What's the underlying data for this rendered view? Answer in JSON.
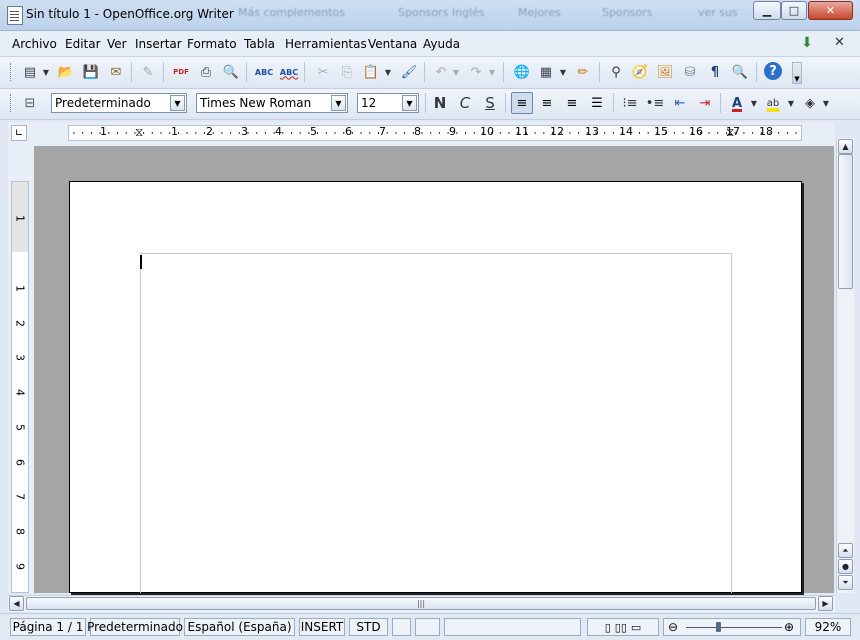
{
  "window": {
    "title": "Sin título 1 - OpenOffice.org Writer",
    "background_tabs": [
      "Más complementos",
      "Sponsors Inglés",
      "Mejores",
      "Sponsors",
      "ver sus"
    ],
    "buttons": {
      "minimize": "▁",
      "maximize": "□",
      "close": "✕"
    }
  },
  "menu": [
    "Archivo",
    "Editar",
    "Ver",
    "Insertar",
    "Formato",
    "Tabla",
    "Herramientas",
    "Ventana",
    "Ayuda"
  ],
  "toolbar_standard": {
    "icons": [
      "new-icon",
      "open-icon",
      "save-icon",
      "email-icon",
      "edit-file-icon",
      "export-pdf-icon",
      "print-icon",
      "page-preview-icon",
      "spellcheck-icon",
      "autospellcheck-icon",
      "cut-icon",
      "copy-icon",
      "paste-icon",
      "format-paintbrush-icon",
      "undo-icon",
      "redo-icon",
      "hyperlink-icon",
      "table-icon",
      "draw-functions-icon",
      "find-replace-icon",
      "navigator-icon",
      "gallery-icon",
      "data-sources-icon",
      "formatting-marks-icon",
      "zoom-icon",
      "help-icon"
    ],
    "glyphs": {
      "new": "▤",
      "open": "📂",
      "save": "💾",
      "email": "✉",
      "edit": "✎",
      "pdf": "PDF",
      "print": "⎙",
      "preview": "🔍",
      "abc": "ABC",
      "abc2": "ABC",
      "cut": "✂",
      "copy": "⎘",
      "paste": "📋",
      "brush": "🖌",
      "undo": "↶",
      "redo": "↷",
      "link": "🌐",
      "table": "▦",
      "draw": "✏",
      "binoculars": "⚲",
      "navigator": "🧭",
      "gallery": "🖼",
      "datasource": "⛁",
      "pilcrow": "¶",
      "zoom": "🔍",
      "help": "?"
    }
  },
  "toolbar_format": {
    "style_value": "Predeterminado",
    "font_value": "Times New Roman",
    "size_value": "12",
    "bold": "N",
    "italic": "C",
    "underline": "S",
    "icons": [
      "styles-icon",
      "align-left-icon",
      "align-center-icon",
      "align-right-icon",
      "justify-icon",
      "numbering-icon",
      "bullets-icon",
      "decrease-indent-icon",
      "increase-indent-icon",
      "font-color-icon",
      "highlight-icon",
      "background-color-icon"
    ]
  },
  "ruler": {
    "h_numbers": [
      "1",
      "1",
      "2",
      "3",
      "4",
      "5",
      "6",
      "7",
      "8",
      "9",
      "10",
      "11",
      "12",
      "13",
      "14",
      "15",
      "16",
      "17",
      "18"
    ],
    "v_numbers": [
      "1",
      "1",
      "2",
      "3",
      "4",
      "5",
      "6",
      "7",
      "8",
      "9"
    ]
  },
  "statusbar": {
    "page": "Página  1 / 1",
    "style": "Predeterminado",
    "language": "Español (España)",
    "insert": "INSERT",
    "selection": "STD",
    "zoom": "92%"
  },
  "zoom": {
    "level_percent": 92
  }
}
